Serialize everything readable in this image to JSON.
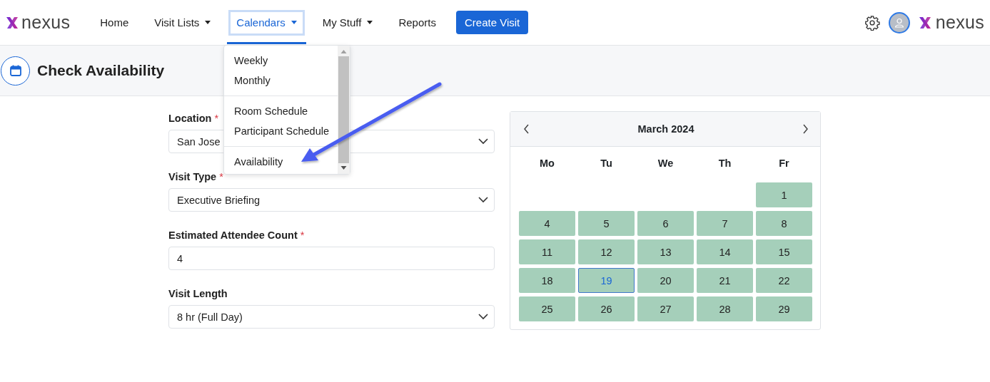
{
  "brand": {
    "name": "nexus"
  },
  "nav": [
    {
      "label": "Home",
      "kind": "link",
      "caret": false,
      "selected": false
    },
    {
      "label": "Visit Lists",
      "kind": "link",
      "caret": true,
      "selected": false
    },
    {
      "label": "Calendars",
      "kind": "link",
      "caret": true,
      "selected": true
    },
    {
      "label": "My Stuff",
      "kind": "link",
      "caret": true,
      "selected": false
    },
    {
      "label": "Reports",
      "kind": "link",
      "caret": false,
      "selected": false
    },
    {
      "label": "Create Visit",
      "kind": "button"
    }
  ],
  "partner_brand": {
    "name": "nexus"
  },
  "page_title": "Check Availability",
  "menu": {
    "groups": [
      [
        "Weekly",
        "Monthly"
      ],
      [
        "Room Schedule",
        "Participant Schedule"
      ],
      [
        "Availability"
      ]
    ]
  },
  "form": [
    {
      "label": "Location",
      "required_mark": "*",
      "kind": "select",
      "value": "San Jose"
    },
    {
      "label": "Visit Type",
      "required_mark": "*",
      "kind": "select",
      "value": "Executive Briefing"
    },
    {
      "label": "Estimated Attendee Count",
      "required_mark": "*",
      "kind": "input",
      "value": "4"
    },
    {
      "label": "Visit Length",
      "kind": "select",
      "value": "8 hr (Full Day)"
    }
  ],
  "calendar": {
    "title": "March 2024",
    "weekdays": [
      "Mo",
      "Tu",
      "We",
      "Th",
      "Fr"
    ],
    "weeks": [
      [
        {
          "kind": "blank"
        },
        {
          "kind": "blank"
        },
        {
          "kind": "blank"
        },
        {
          "kind": "blank"
        },
        {
          "kind": "day",
          "day": "1",
          "selected": false
        }
      ],
      [
        {
          "kind": "day",
          "day": "4",
          "selected": false
        },
        {
          "kind": "day",
          "day": "5",
          "selected": false
        },
        {
          "kind": "day",
          "day": "6",
          "selected": false
        },
        {
          "kind": "day",
          "day": "7",
          "selected": false
        },
        {
          "kind": "day",
          "day": "8",
          "selected": false
        }
      ],
      [
        {
          "kind": "day",
          "day": "11",
          "selected": false
        },
        {
          "kind": "day",
          "day": "12",
          "selected": false
        },
        {
          "kind": "day",
          "day": "13",
          "selected": false
        },
        {
          "kind": "day",
          "day": "14",
          "selected": false
        },
        {
          "kind": "day",
          "day": "15",
          "selected": false
        }
      ],
      [
        {
          "kind": "day",
          "day": "18",
          "selected": false
        },
        {
          "kind": "day",
          "day": "19",
          "selected": true
        },
        {
          "kind": "day",
          "day": "20",
          "selected": false
        },
        {
          "kind": "day",
          "day": "21",
          "selected": false
        },
        {
          "kind": "day",
          "day": "22",
          "selected": false
        }
      ],
      [
        {
          "kind": "day",
          "day": "25",
          "selected": false
        },
        {
          "kind": "day",
          "day": "26",
          "selected": false
        },
        {
          "kind": "day",
          "day": "27",
          "selected": false
        },
        {
          "kind": "day",
          "day": "28",
          "selected": false
        },
        {
          "kind": "day",
          "day": "29",
          "selected": false
        }
      ]
    ]
  }
}
